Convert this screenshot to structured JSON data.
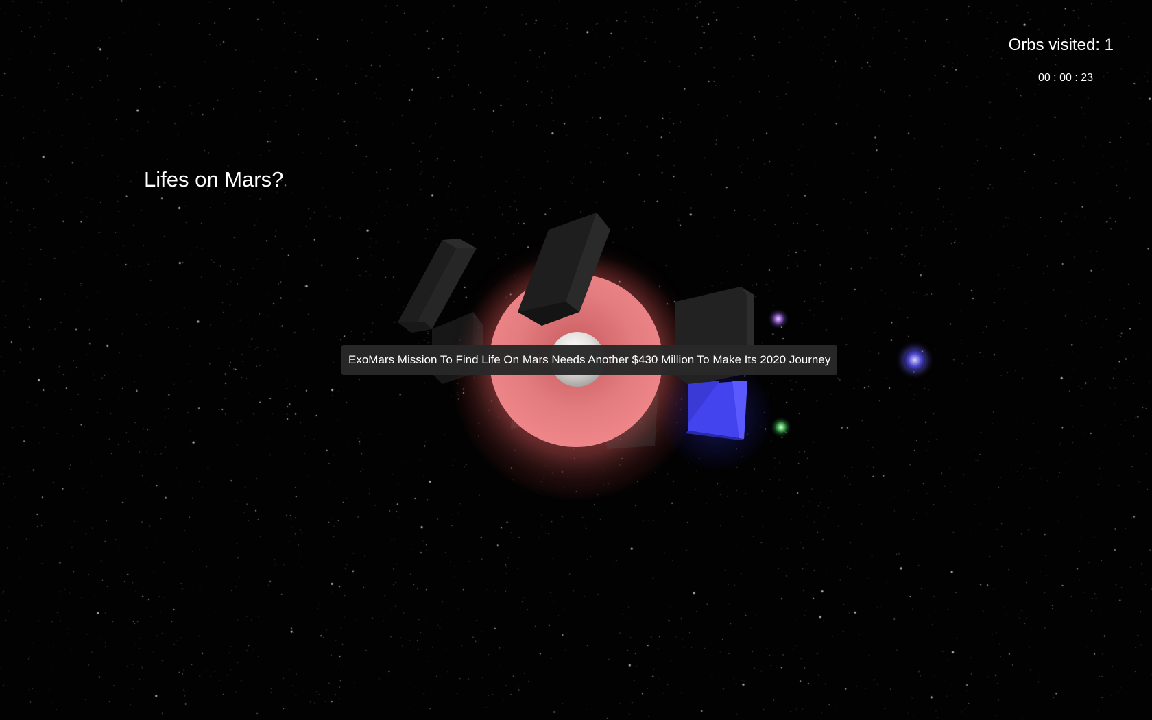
{
  "hud": {
    "orbs_visited": "Orbs visited: 1",
    "timer": "00 : 00 : 23"
  },
  "topic": {
    "title": "Lifes on Mars?"
  },
  "tooltip": {
    "text": "ExoMars Mission To Find Life On Mars Needs Another $430 Million To Make Its 2020 Journey"
  },
  "colors": {
    "background": "#000000",
    "orb_red": "#f2898c",
    "cube_dark": "#222222",
    "cube_blue": "#3a3ae6",
    "orb_purple": "#7a4cb0",
    "orb_green": "#3aa048",
    "orb_blue": "#4a44c8"
  }
}
